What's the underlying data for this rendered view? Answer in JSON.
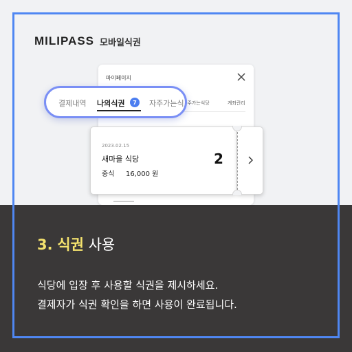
{
  "brand": {
    "name": "MILIPASS",
    "sub": "모바일식권"
  },
  "phone": {
    "title": "마이페이지",
    "tab_extra_1": "자주가는식당",
    "tab_extra_2": "계좌관리"
  },
  "tabs": {
    "history": "결제내역",
    "my_tickets": "나의식권",
    "badge": "7",
    "frequent": "자주가는식"
  },
  "ticket": {
    "date": "2023.02.15",
    "restaurant": "새마을 식당",
    "meal": "중식",
    "price": "16,000 원",
    "count": "2"
  },
  "step": {
    "number": "3.",
    "keyword": "식권",
    "rest": "사용"
  },
  "description": {
    "line1": "식당에 입장 후 사용할 식권을 제시하세요.",
    "line2": "결제자가 식권 확인을 하면 사용이 완료됩니다."
  },
  "colors": {
    "accent": "#4f87f2",
    "highlight": "#f5e36e",
    "dark_bg": "#3a3838"
  }
}
